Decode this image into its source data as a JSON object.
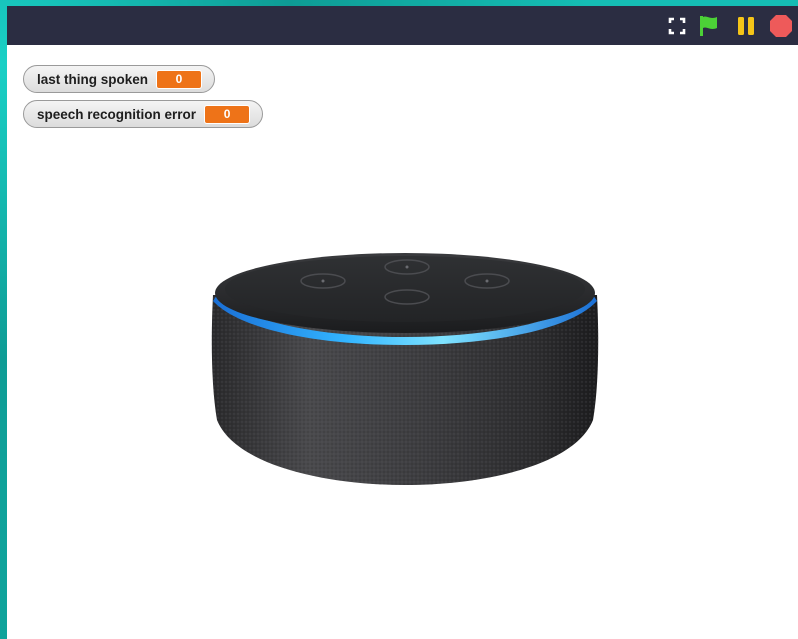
{
  "controls": {
    "fullscreen_icon": "fullscreen-icon",
    "start_icon": "green-flag-icon",
    "pause_icon": "pause-icon",
    "stop_icon": "stop-icon",
    "flag_color": "#4cd137",
    "pause_color": "#f5c518",
    "stop_color": "#ee5a5a"
  },
  "watchers": [
    {
      "label": "last thing spoken",
      "value": "0"
    },
    {
      "label": "speech recognition error",
      "value": "0"
    }
  ],
  "colors": {
    "frame": "#14b8b0",
    "titlebar": "#2b2d42",
    "stage": "#ffffff",
    "watcher_value": "#ee7318",
    "speaker_light_ring": "#2fa8ff"
  },
  "stage": {
    "sprite": "smart-speaker-image"
  }
}
